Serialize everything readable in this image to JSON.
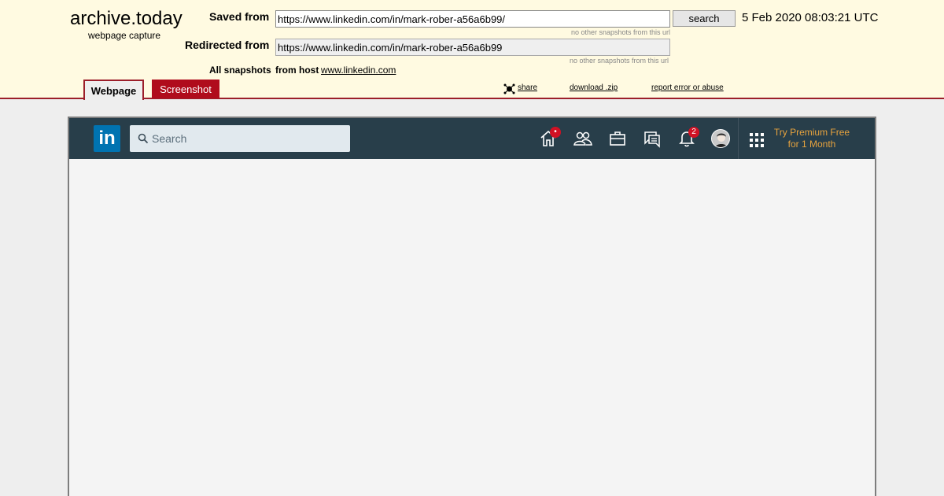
{
  "archive": {
    "title": "archive.today",
    "subtitle": "webpage capture",
    "saved_from_label": "Saved from",
    "saved_from_url": "https://www.linkedin.com/in/mark-rober-a56a6b99/",
    "search_label": "search",
    "timestamp": "5 Feb 2020 08:03:21 UTC",
    "no_other_1": "no other snapshots from this url",
    "redirected_from_label": "Redirected from",
    "redirected_url": "https://www.linkedin.com/in/mark-rober-a56a6b99",
    "no_other_2": "no other snapshots from this url",
    "all_snapshots_label": "All snapshots",
    "from_host_label": "from host",
    "host_link": "www.linkedin.com",
    "tabs": [
      "Webpage",
      "Screenshot"
    ],
    "actions": {
      "share": "share",
      "download": "download .zip",
      "report": "report error or abuse"
    },
    "colors": {
      "header_bg": "#fffae1",
      "accent": "#9c1e2a",
      "screenshot_tab": "#b00c1c"
    }
  },
  "linkedin": {
    "logo": "in",
    "search_placeholder": "Search",
    "nav_icons": [
      "home-icon",
      "my-network-icon",
      "jobs-icon",
      "messaging-icon",
      "notifications-icon",
      "profile-avatar"
    ],
    "home_badge": "•",
    "notifications_badge": "2",
    "premium_line1": "Try Premium Free",
    "premium_line2": "for 1 Month",
    "colors": {
      "nav_bg": "#283e4a",
      "logo_bg": "#0073b1",
      "premium": "#e7a33e",
      "badge": "#d11124"
    }
  }
}
